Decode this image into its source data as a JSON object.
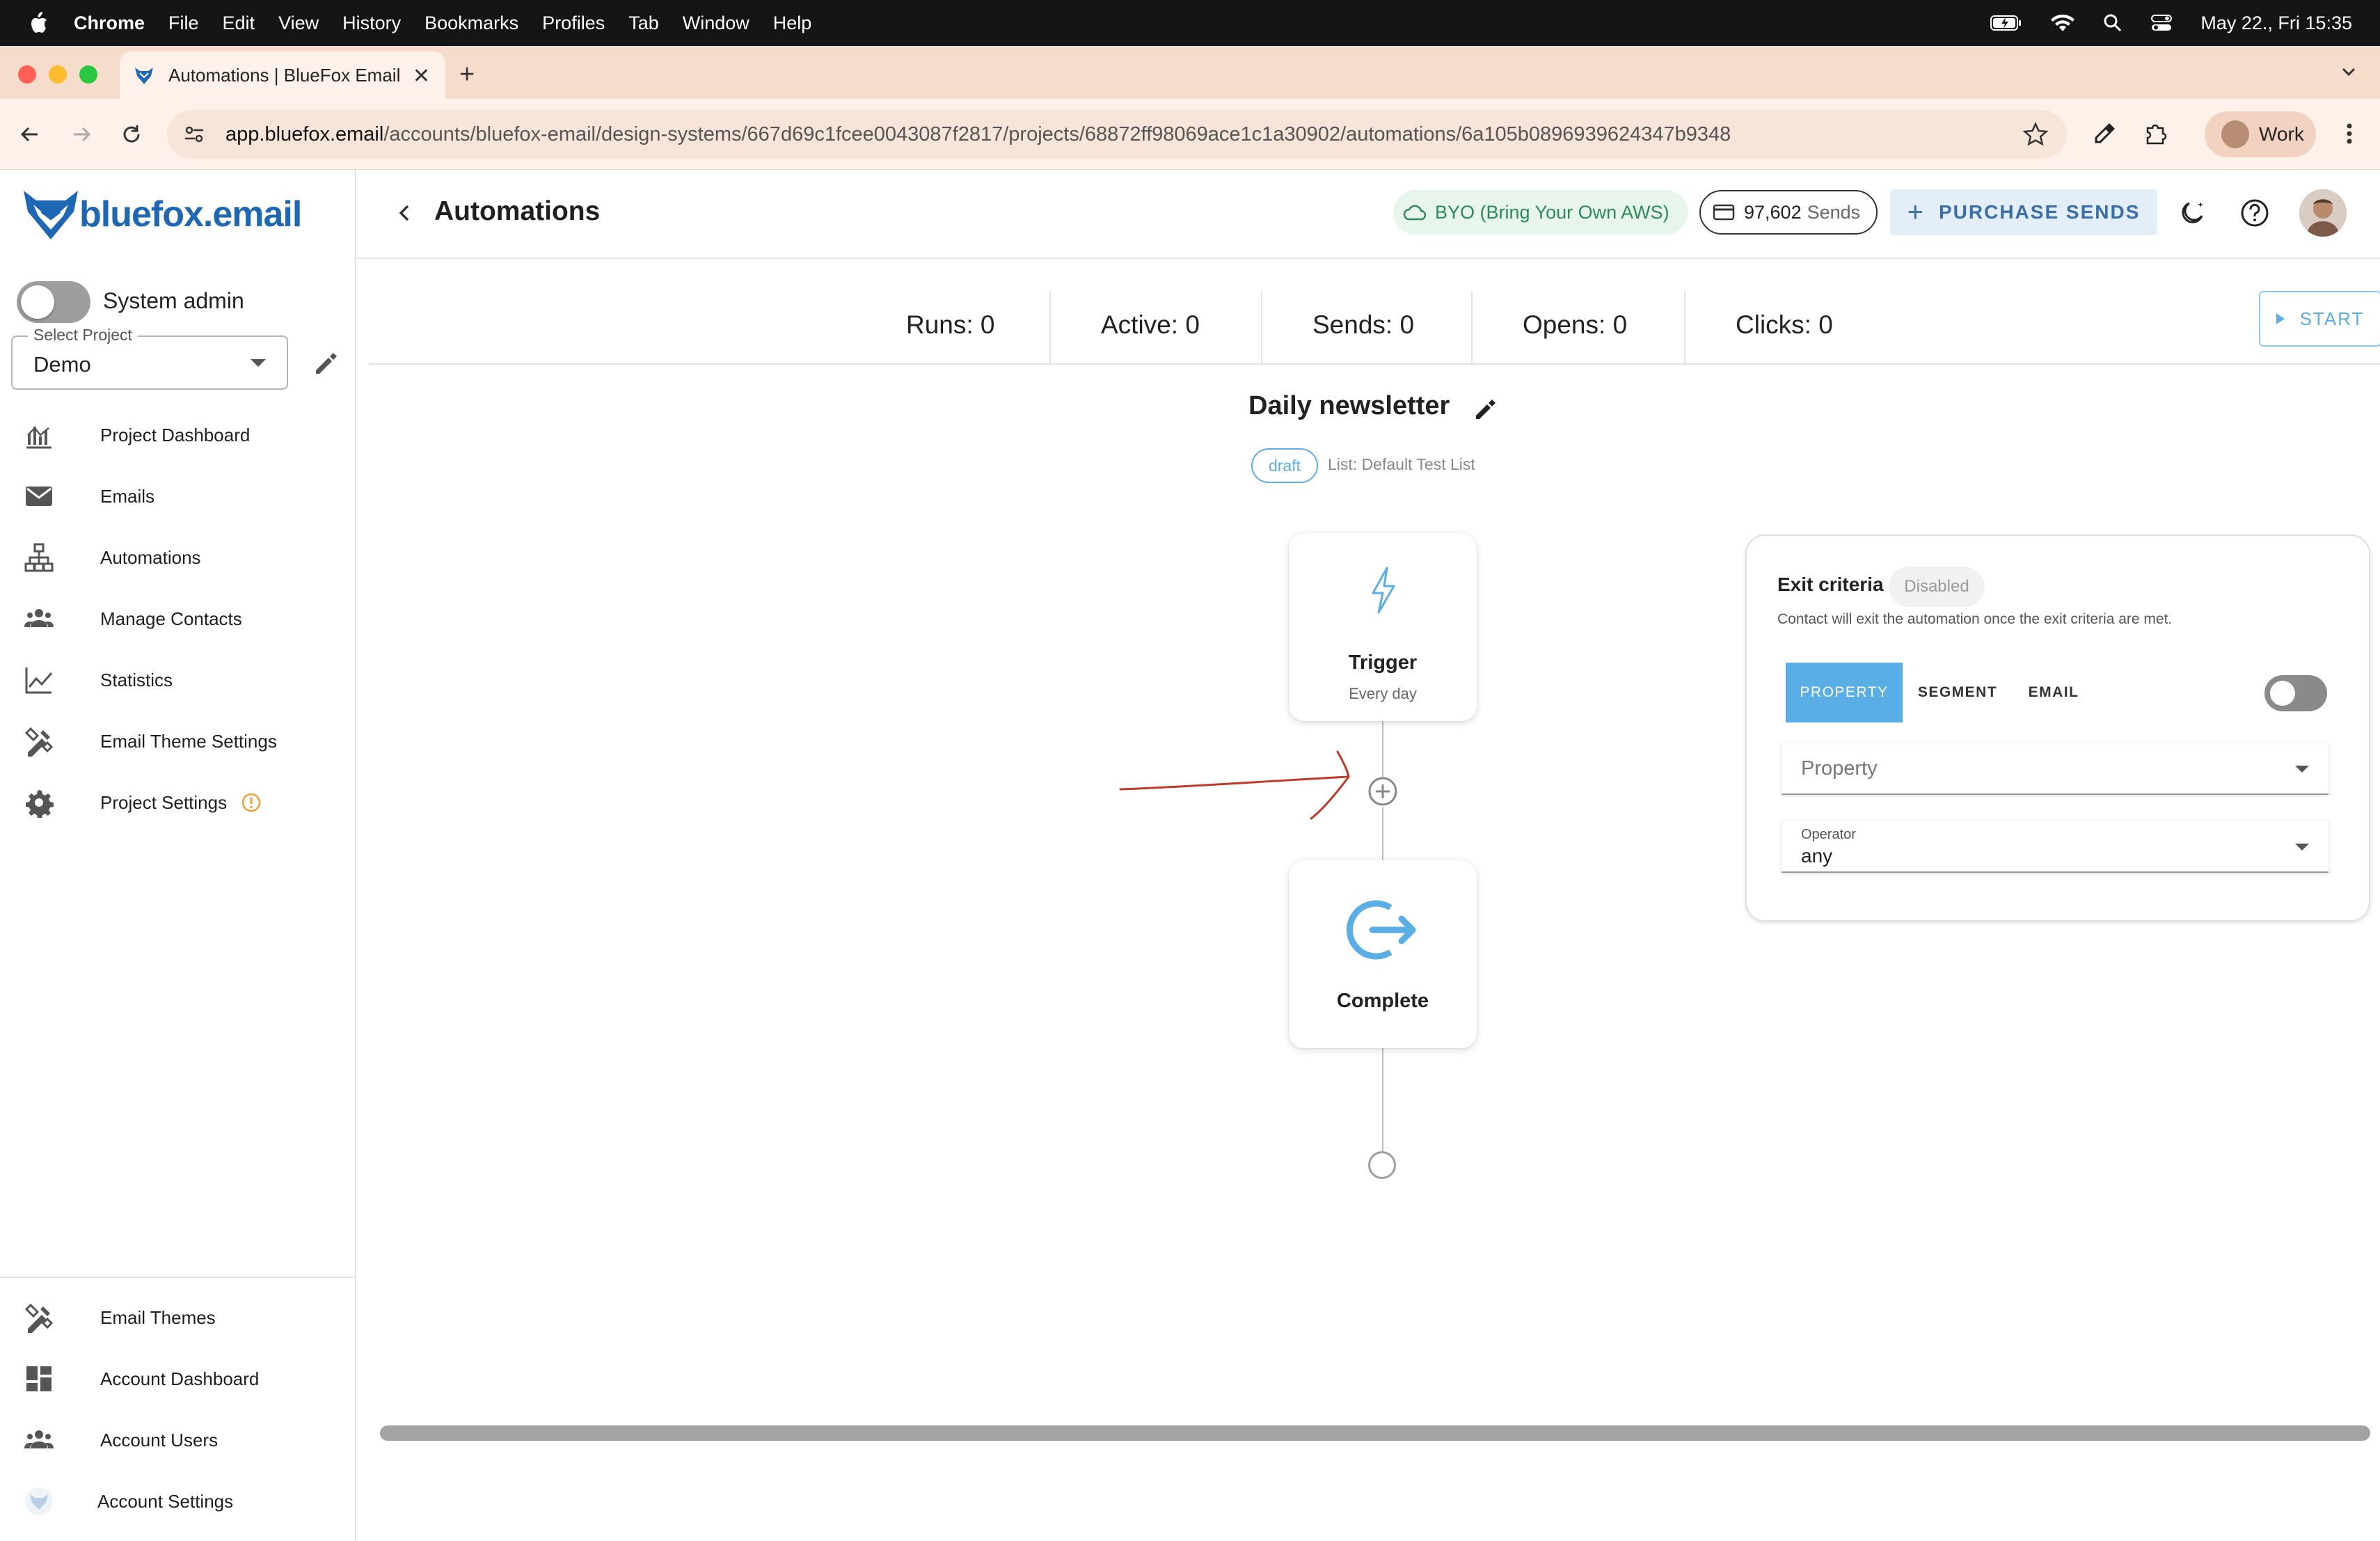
{
  "menubar": {
    "app": "Chrome",
    "items": [
      "File",
      "Edit",
      "View",
      "History",
      "Bookmarks",
      "Profiles",
      "Tab",
      "Window",
      "Help"
    ],
    "clock": "May 22., Fri  15:35"
  },
  "browser": {
    "tab_title": "Automations | BlueFox Email",
    "url_host": "app.bluefox.email",
    "url_path": "/accounts/bluefox-email/design-systems/667d69c1fcee0043087f2817/projects/68872ff98069ace1c1a30902/automations/6a105b0896939624347b9348",
    "profile_label": "Work"
  },
  "logo": {
    "name": "bluefox",
    "suffix": ".email"
  },
  "sidebar": {
    "system_admin_label": "System admin",
    "project_select_legend": "Select Project",
    "project_select_value": "Demo",
    "items": [
      {
        "label": "Project Dashboard",
        "icon": "chart-bars-icon"
      },
      {
        "label": "Emails",
        "icon": "envelope-icon"
      },
      {
        "label": "Automations",
        "icon": "sitemap-icon"
      },
      {
        "label": "Manage Contacts",
        "icon": "people-icon"
      },
      {
        "label": "Statistics",
        "icon": "line-chart-icon"
      },
      {
        "label": "Email Theme Settings",
        "icon": "design-tools-icon"
      },
      {
        "label": "Project Settings",
        "icon": "gear-icon"
      }
    ],
    "bottom_items": [
      {
        "label": "Email Themes",
        "icon": "design-tools-icon"
      },
      {
        "label": "Account Dashboard",
        "icon": "dashboard-icon"
      },
      {
        "label": "Account Users",
        "icon": "people-icon"
      },
      {
        "label": "Account Settings",
        "icon": "fox-avatar-icon"
      }
    ]
  },
  "header": {
    "title": "Automations",
    "byo_label": "BYO (Bring Your Own AWS)",
    "sends_count": "97,602",
    "sends_unit": "Sends",
    "purchase_label": "PURCHASE SENDS"
  },
  "stats": {
    "runs": "Runs: 0",
    "active": "Active: 0",
    "sends": "Sends: 0",
    "opens": "Opens: 0",
    "clicks": "Clicks: 0",
    "start_label": "START"
  },
  "automation": {
    "name": "Daily newsletter",
    "status": "draft",
    "list": "List: Default Test List",
    "trigger_title": "Trigger",
    "trigger_sub": "Every day",
    "complete_title": "Complete"
  },
  "exit_criteria": {
    "title": "Exit criteria",
    "status": "Disabled",
    "description": "Contact will exit the automation once the exit criteria are met.",
    "tabs": [
      "PROPERTY",
      "SEGMENT",
      "EMAIL"
    ],
    "active_tab": "PROPERTY",
    "property_placeholder": "Property",
    "operator_label": "Operator",
    "operator_value": "any"
  },
  "colors": {
    "accent": "#5aaee6",
    "brand": "#1e67b5",
    "annotation": "#c0392b"
  }
}
